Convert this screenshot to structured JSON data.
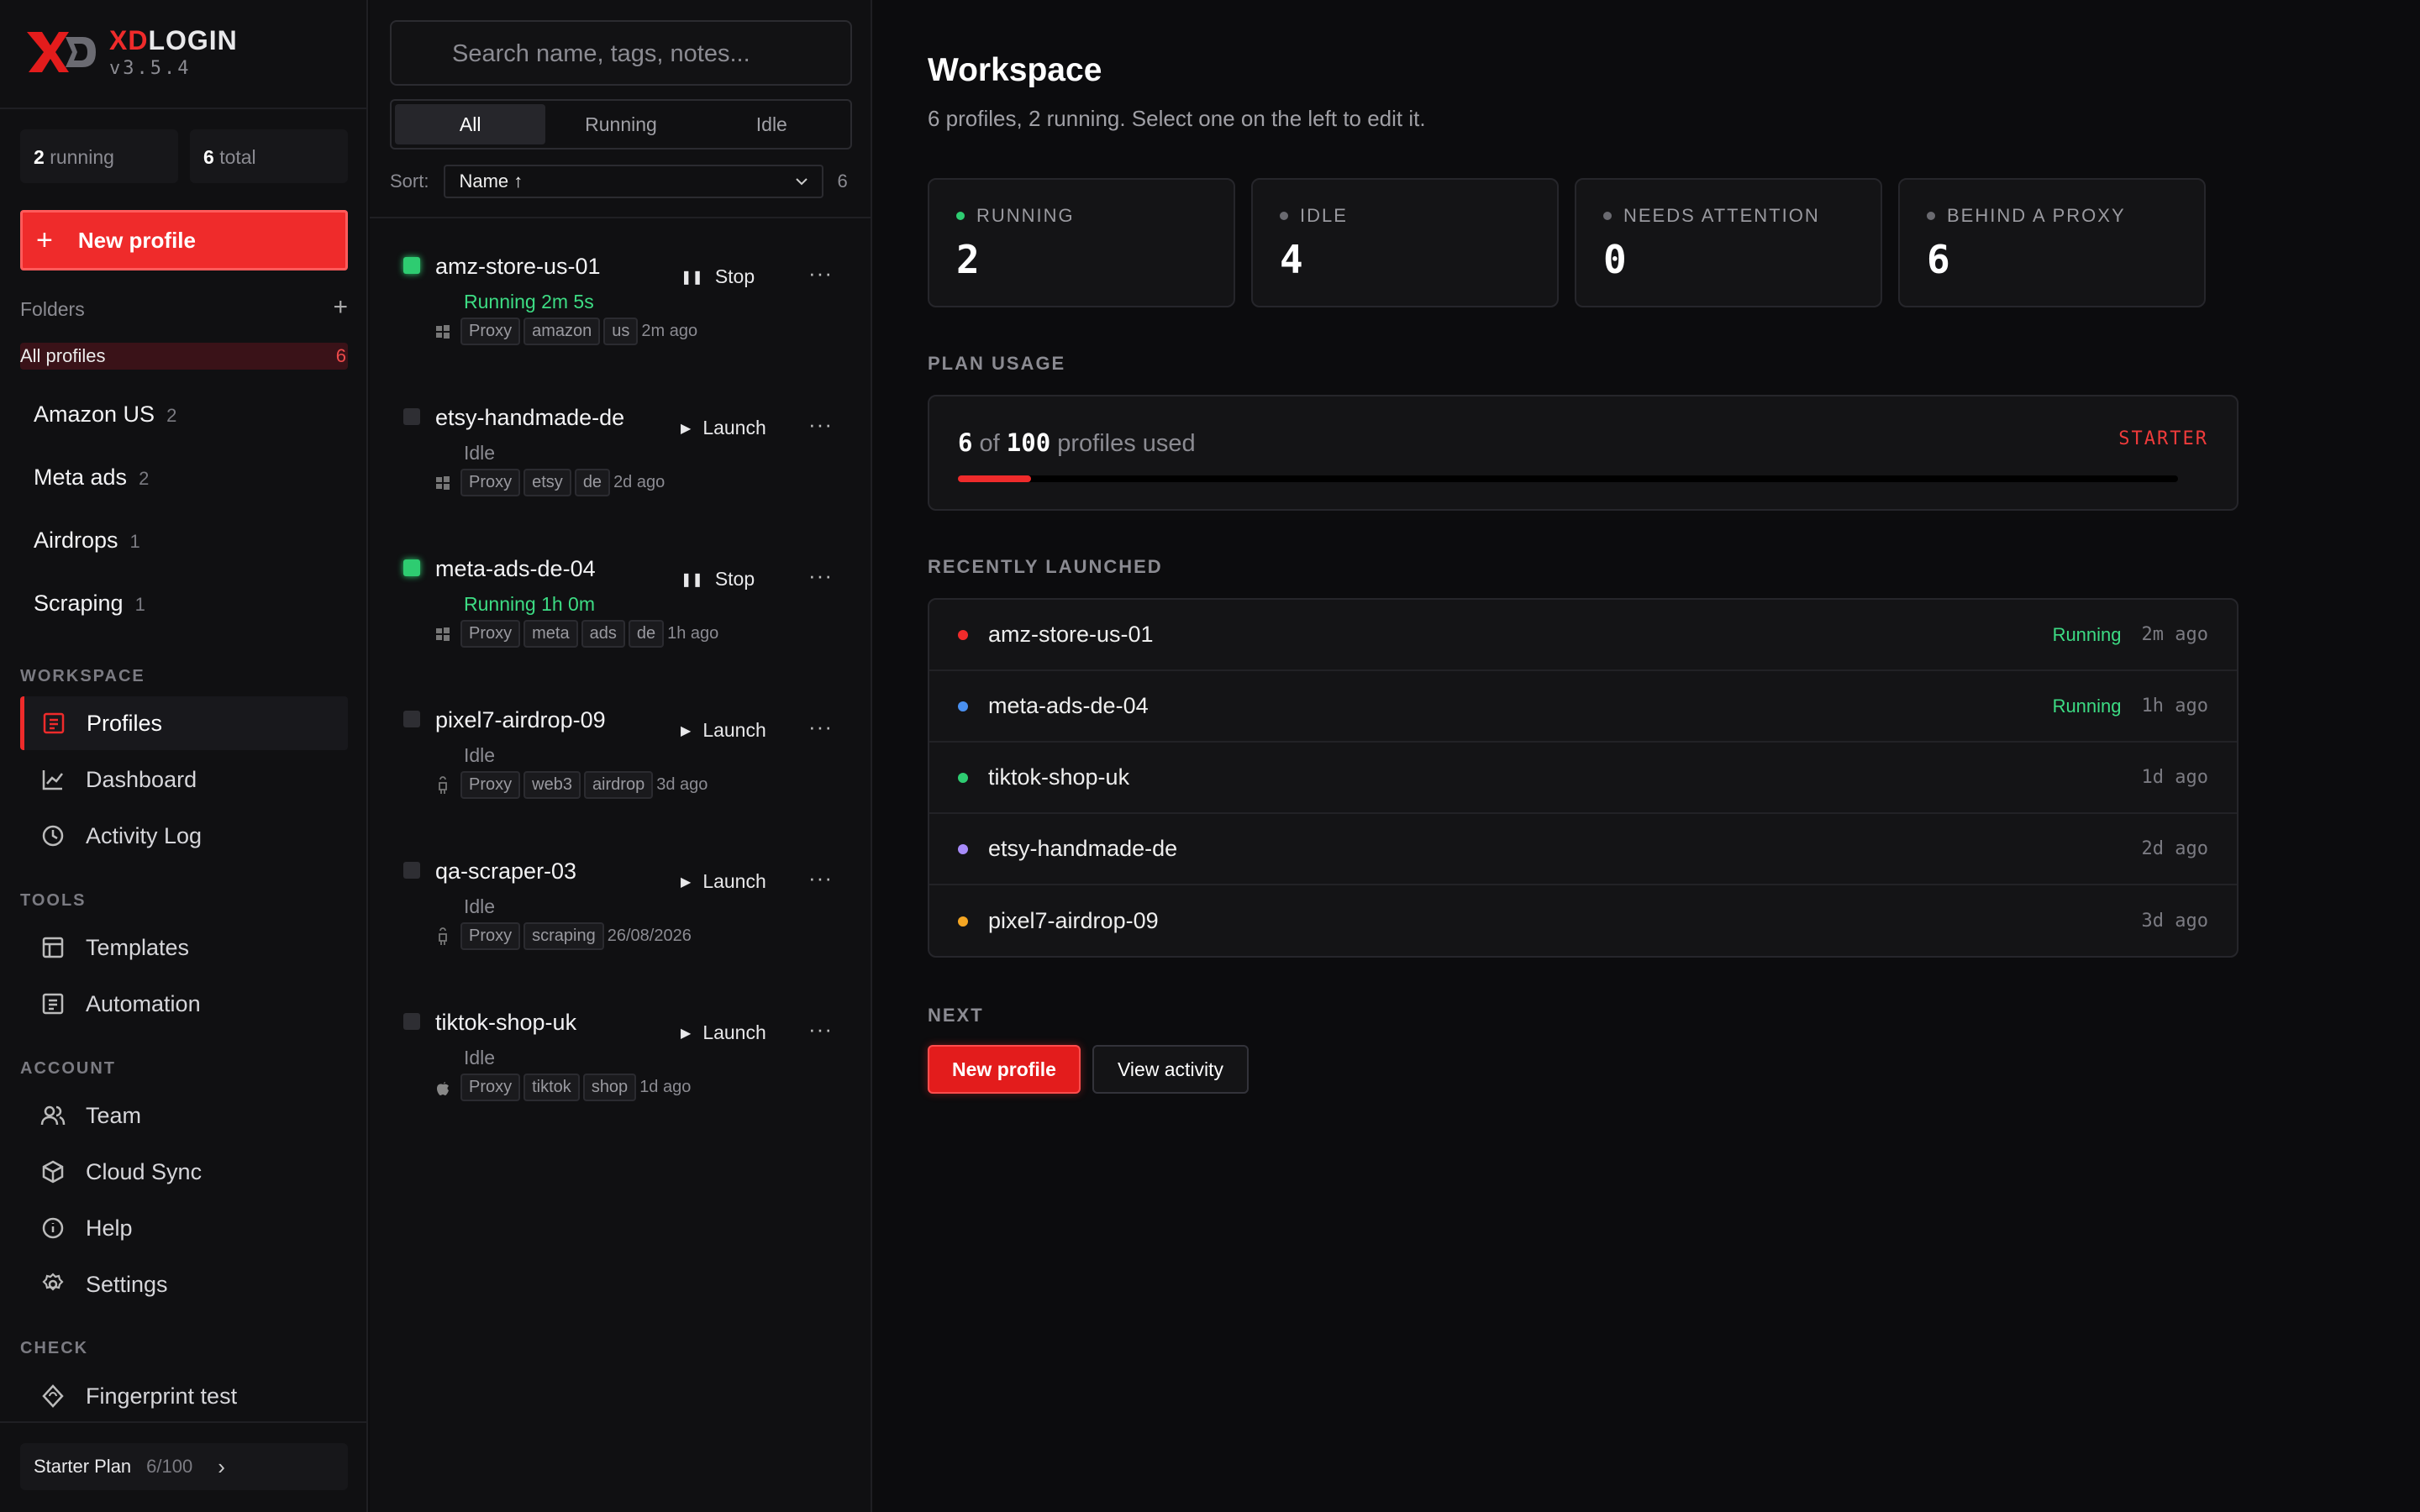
{
  "brand": {
    "name_red": "XD",
    "name_rest": "LOGIN",
    "version": "v3.5.4"
  },
  "sidebar": {
    "running_count": "2",
    "running_label": "running",
    "total_count": "6",
    "total_label": "total",
    "new_profile": "New profile",
    "folders_label": "Folders",
    "all_profiles": {
      "label": "All profiles",
      "count": "6"
    },
    "folders": [
      {
        "label": "Amazon US",
        "count": "2"
      },
      {
        "label": "Meta ads",
        "count": "2"
      },
      {
        "label": "Airdrops",
        "count": "1"
      },
      {
        "label": "Scraping",
        "count": "1"
      }
    ],
    "sections": {
      "workspace": "WORKSPACE",
      "tools": "TOOLS",
      "account": "ACCOUNT",
      "check": "CHECK"
    },
    "nav": {
      "profiles": "Profiles",
      "dashboard": "Dashboard",
      "activity": "Activity Log",
      "templates": "Templates",
      "automation": "Automation",
      "team": "Team",
      "cloud": "Cloud Sync",
      "help": "Help",
      "settings": "Settings",
      "fingerprint": "Fingerprint test"
    },
    "plan": {
      "label": "Starter Plan",
      "count": "6/100"
    }
  },
  "list": {
    "search_placeholder": "Search name, tags, notes...",
    "filters": [
      "All",
      "Running",
      "Idle"
    ],
    "sort_label": "Sort:",
    "sort_value": "Name ↑",
    "count": "6",
    "profiles": [
      {
        "name": "amz-store-us-01",
        "status": "Running 2m 5s",
        "running": true,
        "action": "Stop",
        "os": "windows",
        "tags": [
          "Proxy",
          "amazon",
          "us"
        ],
        "ago": "2m ago"
      },
      {
        "name": "etsy-handmade-de",
        "status": "Idle",
        "running": false,
        "action": "Launch",
        "os": "windows",
        "tags": [
          "Proxy",
          "etsy",
          "de"
        ],
        "ago": "2d ago"
      },
      {
        "name": "meta-ads-de-04",
        "status": "Running 1h 0m",
        "running": true,
        "action": "Stop",
        "os": "windows",
        "tags": [
          "Proxy",
          "meta",
          "ads",
          "de"
        ],
        "ago": "1h ago"
      },
      {
        "name": "pixel7-airdrop-09",
        "status": "Idle",
        "running": false,
        "action": "Launch",
        "os": "android",
        "tags": [
          "Proxy",
          "web3",
          "airdrop"
        ],
        "ago": "3d ago"
      },
      {
        "name": "qa-scraper-03",
        "status": "Idle",
        "running": false,
        "action": "Launch",
        "os": "android",
        "tags": [
          "Proxy",
          "scraping"
        ],
        "ago": "26/08/2026"
      },
      {
        "name": "tiktok-shop-uk",
        "status": "Idle",
        "running": false,
        "action": "Launch",
        "os": "apple",
        "tags": [
          "Proxy",
          "tiktok",
          "shop"
        ],
        "ago": "1d ago"
      }
    ]
  },
  "main": {
    "title": "Workspace",
    "subtitle": "6 profiles, 2 running. Select one on the left to edit it.",
    "cards": [
      {
        "label": "RUNNING",
        "value": "2",
        "dot": "#2ecc71"
      },
      {
        "label": "IDLE",
        "value": "4",
        "dot": "#6a6a70"
      },
      {
        "label": "NEEDS ATTENTION",
        "value": "0",
        "dot": "#6a6a70"
      },
      {
        "label": "BEHIND A PROXY",
        "value": "6",
        "dot": "#6a6a70"
      }
    ],
    "plan_usage_label": "PLAN USAGE",
    "usage": {
      "used": "6",
      "of": "of",
      "max": "100",
      "suffix": "profiles used",
      "plan": "STARTER",
      "fraction": 0.06
    },
    "recent_label": "RECENTLY LAUNCHED",
    "recent": [
      {
        "name": "amz-store-us-01",
        "status": "Running",
        "ago": "2m ago",
        "dot": "#ef2b2b"
      },
      {
        "name": "meta-ads-de-04",
        "status": "Running",
        "ago": "1h ago",
        "dot": "#4a90f0"
      },
      {
        "name": "tiktok-shop-uk",
        "status": "",
        "ago": "1d ago",
        "dot": "#2ecc71"
      },
      {
        "name": "etsy-handmade-de",
        "status": "",
        "ago": "2d ago",
        "dot": "#a78bfa"
      },
      {
        "name": "pixel7-airdrop-09",
        "status": "",
        "ago": "3d ago",
        "dot": "#f5a623"
      }
    ],
    "next_label": "NEXT",
    "new_profile": "New profile",
    "view_activity": "View activity"
  },
  "colors": {
    "accent": "#ef2b2b",
    "running": "#3ddc84"
  }
}
